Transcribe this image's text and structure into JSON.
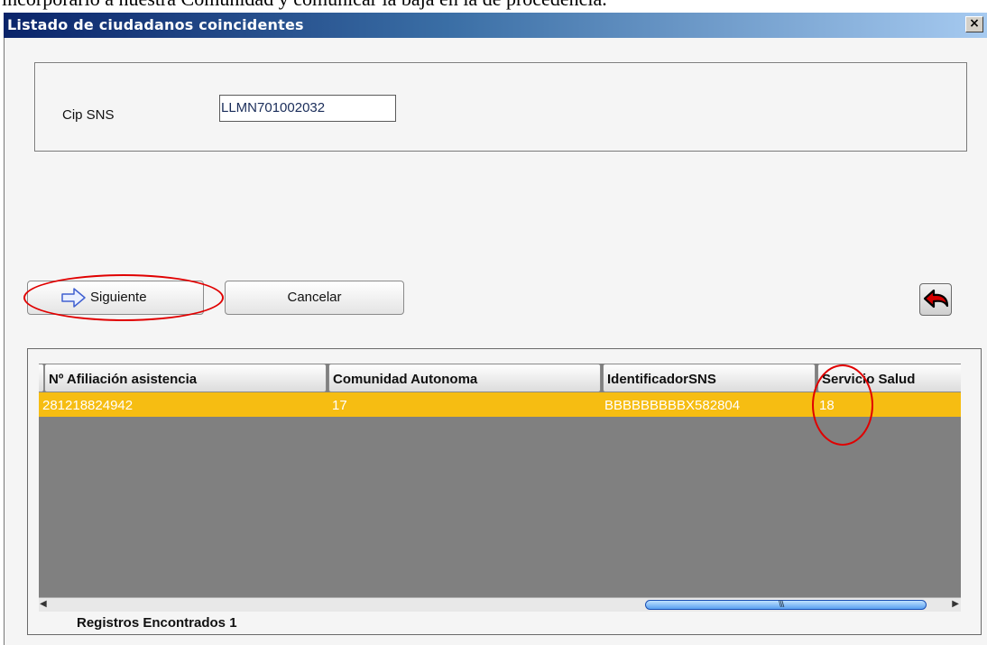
{
  "background_text": "incorporarlo a nuestra Comunidad y comunicar la baja en la de procedencia.",
  "window": {
    "title": "Listado de ciudadanos coincidentes",
    "close_label": "×"
  },
  "form": {
    "cip_label": "Cip SNS",
    "cip_value": "LLMN701002032"
  },
  "buttons": {
    "next_label": "Siguiente",
    "cancel_label": "Cancelar"
  },
  "table": {
    "columns": [
      "Nº Afiliación asistencia",
      "Comunidad Autonoma",
      "IdentificadorSNS",
      "Servicio Salud"
    ],
    "rows": [
      [
        "281218824942",
        "17",
        "BBBBBBBBBX582804",
        "18"
      ]
    ]
  },
  "footer": {
    "records_label": "Registros Encontrados 1"
  },
  "icons": {
    "next_arrow": "arrow-right-icon",
    "back": "back-arrow-icon",
    "close": "close-icon"
  },
  "colors": {
    "title_bar_start": "#0a246a",
    "title_bar_end": "#a6caf0",
    "selected_row": "#f6bd12",
    "grid_background": "#808080",
    "annotation": "#e00000",
    "back_icon_fill": "#d40000"
  }
}
